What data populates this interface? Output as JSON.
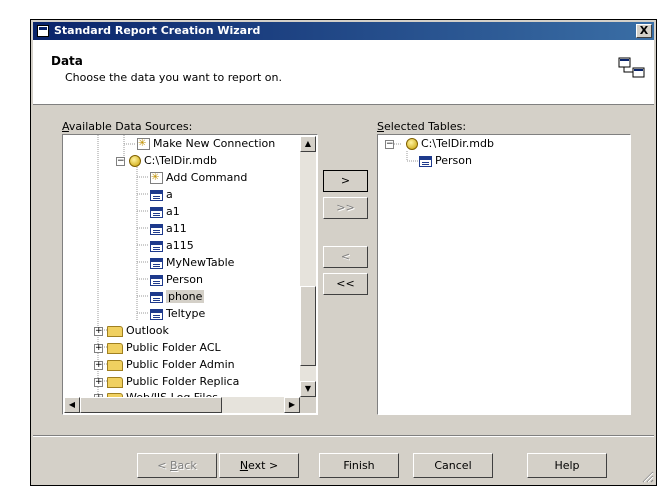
{
  "window": {
    "title": "Standard Report Creation Wizard",
    "close_label": "X"
  },
  "header": {
    "title": "Data",
    "subtitle": "Choose the data you want to report on."
  },
  "available": {
    "label_u": "A",
    "label_rest": "vailable Data Sources:",
    "items": [
      {
        "label": "Make New Connection",
        "icon": "new-connection-icon"
      },
      {
        "label": "C:\\TelDir.mdb",
        "icon": "database-icon"
      },
      {
        "label": "Add Command",
        "icon": "add-command-icon"
      },
      {
        "label": "a",
        "icon": "table-icon"
      },
      {
        "label": "a1",
        "icon": "table-icon"
      },
      {
        "label": "a11",
        "icon": "table-icon"
      },
      {
        "label": "a115",
        "icon": "table-icon"
      },
      {
        "label": "MyNewTable",
        "icon": "table-icon"
      },
      {
        "label": "Person",
        "icon": "table-icon"
      },
      {
        "label": "phone",
        "icon": "table-icon"
      },
      {
        "label": "Teltype",
        "icon": "table-icon"
      },
      {
        "label": "Outlook",
        "icon": "folder-icon"
      },
      {
        "label": "Public Folder ACL",
        "icon": "folder-icon"
      },
      {
        "label": "Public Folder Admin",
        "icon": "folder-icon"
      },
      {
        "label": "Public Folder Replica",
        "icon": "folder-icon"
      },
      {
        "label": "Web/IIS Log Files",
        "icon": "folder-icon"
      }
    ]
  },
  "selected": {
    "label_u": "S",
    "label_rest": "elected Tables:",
    "items": [
      {
        "label": "C:\\TelDir.mdb",
        "icon": "database-icon"
      },
      {
        "label": "Person",
        "icon": "table-icon"
      }
    ]
  },
  "transfer": {
    "add_one": ">",
    "add_all": ">>",
    "remove_one": "<",
    "remove_all": "<<"
  },
  "footer": {
    "back_u": "B",
    "back_rest": "ack",
    "back_prefix": "< ",
    "next_u": "N",
    "next_rest": "ext >",
    "finish": "Finish",
    "cancel": "Cancel",
    "help": "Help"
  }
}
